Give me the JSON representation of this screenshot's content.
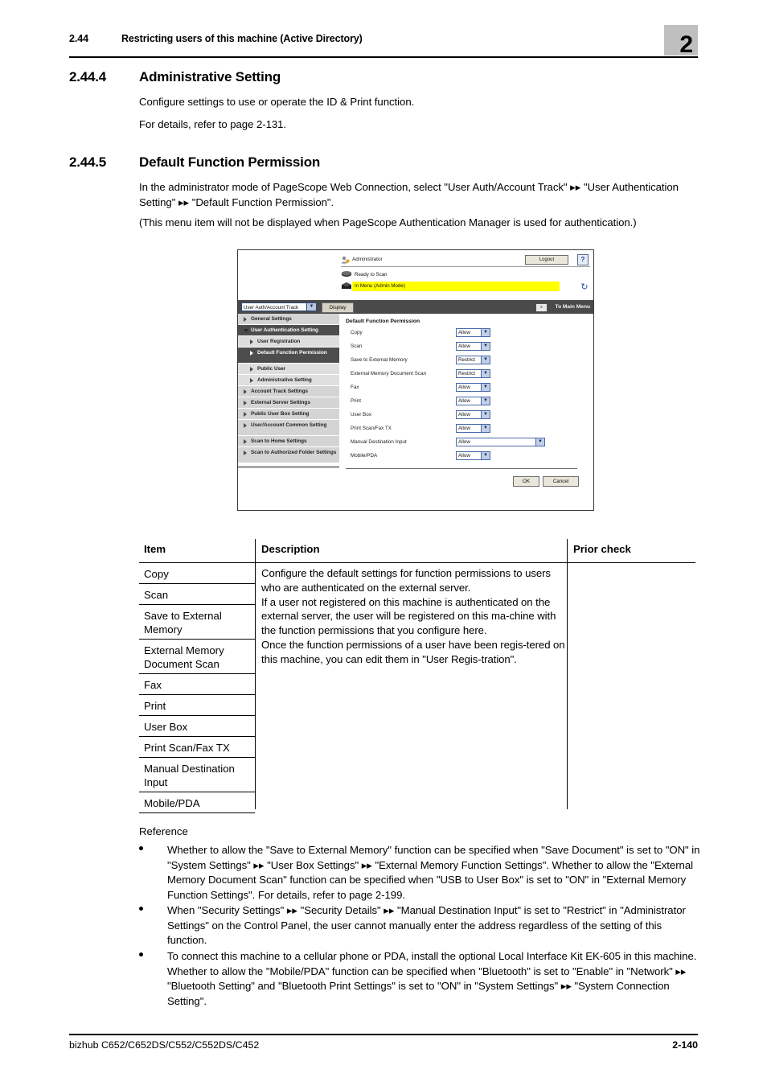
{
  "header": {
    "section_number": "2.44",
    "section_title": "Restricting users of this machine (Active Directory)",
    "chapter_badge": "2"
  },
  "sections": [
    {
      "number": "2.44.4",
      "title": "Administrative Setting",
      "paragraphs": [
        "Configure settings to use or operate the ID & Print function.",
        "For details, refer to page 2-131."
      ]
    },
    {
      "number": "2.44.5",
      "title": "Default Function Permission",
      "paragraphs": [
        "In the administrator mode of PageScope Web Connection, select \"User Auth/Account Track\" ▸▸ \"User Authentication Setting\" ▸▸ \"Default Function Permission\".",
        "(This menu item will not be displayed when PageScope Authentication Manager is used for authentication.)"
      ]
    }
  ],
  "screenshot": {
    "user_label": "Administrator",
    "logout_label": "Logout",
    "help_label": "?",
    "status_ready": "Ready to Scan",
    "status_menu": "In Menu (Admin Mode)",
    "refresh_label": "↻",
    "selector_value": "User Auth/Account Track",
    "display_button": "Display",
    "to_main_menu": "To Main Menu",
    "nav": [
      {
        "label": "General Settings",
        "level": 1,
        "active": false,
        "expanded": false
      },
      {
        "label": "User Authentication Setting",
        "level": 1,
        "active": true,
        "expanded": true
      },
      {
        "label": "User Registration",
        "level": 2,
        "active": false,
        "expanded": false
      },
      {
        "label": "Default Function Permission",
        "level": 2,
        "active": true,
        "expanded": false
      },
      {
        "label": "Public User",
        "level": 2,
        "active": false,
        "expanded": false
      },
      {
        "label": "Administrative Setting",
        "level": 2,
        "active": false,
        "expanded": false
      },
      {
        "label": "Account Track Settings",
        "level": 1,
        "active": false,
        "expanded": false
      },
      {
        "label": "External Server Settings",
        "level": 1,
        "active": false,
        "expanded": false
      },
      {
        "label": "Public User Box Setting",
        "level": 1,
        "active": false,
        "expanded": false
      },
      {
        "label": "User/Account Common Setting",
        "level": 1,
        "active": false,
        "expanded": false
      },
      {
        "label": "Scan to Home Settings",
        "level": 1,
        "active": false,
        "expanded": false
      },
      {
        "label": "Scan to Authorized Folder Settings",
        "level": 1,
        "active": false,
        "expanded": false
      }
    ],
    "panel_title": "Default Function Permission",
    "permissions": [
      {
        "label": "Copy",
        "value": "Allow",
        "wide": false
      },
      {
        "label": "Scan",
        "value": "Allow",
        "wide": false
      },
      {
        "label": "Save to External Memory",
        "value": "Restrict",
        "wide": false
      },
      {
        "label": "External Memory Document Scan",
        "value": "Restrict",
        "wide": false
      },
      {
        "label": "Fax",
        "value": "Allow",
        "wide": false
      },
      {
        "label": "Print",
        "value": "Allow",
        "wide": false
      },
      {
        "label": "User Box",
        "value": "Allow",
        "wide": false
      },
      {
        "label": "Print Scan/Fax TX",
        "value": "Allow",
        "wide": false
      },
      {
        "label": "Manual Destination Input",
        "value": "Allow",
        "wide": true
      },
      {
        "label": "Mobile/PDA",
        "value": "Allow",
        "wide": false
      }
    ],
    "ok_label": "OK",
    "cancel_label": "Cancel"
  },
  "table": {
    "headers": [
      "Item",
      "Description",
      "Prior check"
    ],
    "items": [
      "Copy",
      "Scan",
      "Save to External Memory",
      "External Memory Document Scan",
      "Fax",
      "Print",
      "User Box",
      "Print Scan/Fax TX",
      "Manual Destination Input",
      "Mobile/PDA"
    ],
    "description": "Configure the default settings for function permissions to users who are authenticated on the external server.\nIf a user not registered on this machine is authenticated on the external server, the user will be registered on this ma-chine with the function permissions that you configure here.\nOnce the function permissions of a user have been regis-tered on this machine, you can edit them in \"User Regis-tration\".",
    "prior_check": ""
  },
  "reference": {
    "heading": "Reference",
    "items": [
      "Whether to allow the \"Save to External Memory\" function can be specified when \"Save Document\" is set to \"ON\" in \"System Settings\" ▸▸ \"User Box Settings\" ▸▸ \"External Memory Function Settings\". Whether to allow the \"External Memory Document Scan\" function can be specified when \"USB to User Box\" is set to \"ON\" in \"External Memory Function Settings\". For details, refer to page 2-199.",
      "When \"Security Settings\" ▸▸ \"Security Details\" ▸▸ \"Manual Destination Input\" is set to \"Restrict\" in \"Administrator Settings\" on the Control Panel, the user cannot manually enter the address regardless of the setting of this function.",
      "To connect this machine to a cellular phone or PDA, install the optional Local Interface Kit EK-605 in this machine. Whether to allow the \"Mobile/PDA\" function can be specified when \"Bluetooth\" is set to \"Enable\" in \"Network\" ▸▸ \"Bluetooth Setting\" and \"Bluetooth Print Settings\" is set to \"ON\" in \"System Settings\" ▸▸ \"System Connection Setting\"."
    ]
  },
  "footer": {
    "model": "bizhub C652/C652DS/C552/C552DS/C452",
    "page": "2-140"
  }
}
